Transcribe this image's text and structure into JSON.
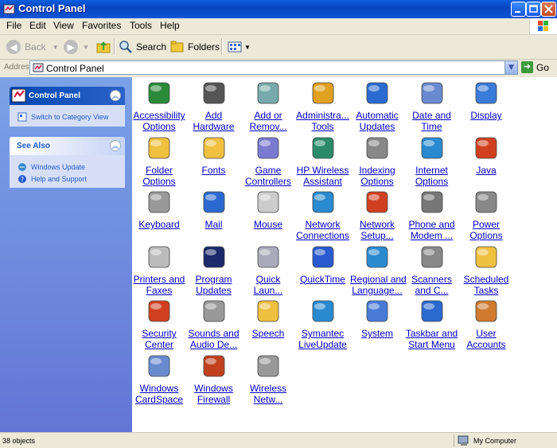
{
  "window": {
    "title": "Control Panel"
  },
  "menu": [
    "File",
    "Edit",
    "View",
    "Favorites",
    "Tools",
    "Help"
  ],
  "toolbar": {
    "back_label": "Back",
    "search_label": "Search",
    "folders_label": "Folders"
  },
  "address": {
    "label": "Address",
    "value": "Control Panel",
    "go_label": "Go"
  },
  "sidebar": {
    "control_panel": {
      "title": "Control Panel",
      "link": "Switch to Category View"
    },
    "see_also": {
      "title": "See Also",
      "links": [
        "Windows Update",
        "Help and Support"
      ]
    }
  },
  "items": [
    {
      "l1": "Accessibility",
      "l2": "Options",
      "icon": "accessibility-icon",
      "color": "#2a8a3a"
    },
    {
      "l1": "Add",
      "l2": "Hardware",
      "icon": "hardware-icon",
      "color": "#555"
    },
    {
      "l1": "Add or",
      "l2": "Remov...",
      "icon": "add-remove-programs-icon",
      "color": "#7aa"
    },
    {
      "l1": "Administra...",
      "l2": "Tools",
      "icon": "admin-tools-icon",
      "color": "#e0a020"
    },
    {
      "l1": "Automatic",
      "l2": "Updates",
      "icon": "automatic-updates-icon",
      "color": "#2a6ad0"
    },
    {
      "l1": "Date and",
      "l2": "Time",
      "icon": "date-time-icon",
      "color": "#6a8ad0"
    },
    {
      "l1": "Display",
      "l2": "",
      "icon": "display-icon",
      "color": "#3a7ad8"
    },
    {
      "l1": "Folder",
      "l2": "Options",
      "icon": "folder-options-icon",
      "color": "#f0c040"
    },
    {
      "l1": "Fonts",
      "l2": "",
      "icon": "fonts-icon",
      "color": "#f0c040"
    },
    {
      "l1": "Game",
      "l2": "Controllers",
      "icon": "game-controller-icon",
      "color": "#7a7ad0"
    },
    {
      "l1": "HP Wireless",
      "l2": "Assistant",
      "icon": "hp-wireless-icon",
      "color": "#2a8a6a"
    },
    {
      "l1": "Indexing",
      "l2": "Options",
      "icon": "indexing-icon",
      "color": "#888"
    },
    {
      "l1": "Internet",
      "l2": "Options",
      "icon": "internet-options-icon",
      "color": "#2a8ad0"
    },
    {
      "l1": "Java",
      "l2": "",
      "icon": "java-icon",
      "color": "#d04020"
    },
    {
      "l1": "Keyboard",
      "l2": "",
      "icon": "keyboard-icon",
      "color": "#999"
    },
    {
      "l1": "Mail",
      "l2": "",
      "icon": "mail-icon",
      "color": "#2a6ad0"
    },
    {
      "l1": "Mouse",
      "l2": "",
      "icon": "mouse-icon",
      "color": "#ccc"
    },
    {
      "l1": "Network",
      "l2": "Connections",
      "icon": "network-connections-icon",
      "color": "#2a8ad0"
    },
    {
      "l1": "Network",
      "l2": "Setup...",
      "icon": "network-setup-icon",
      "color": "#d04020"
    },
    {
      "l1": "Phone and",
      "l2": "Modem ...",
      "icon": "phone-modem-icon",
      "color": "#777"
    },
    {
      "l1": "Power",
      "l2": "Options",
      "icon": "power-options-icon",
      "color": "#888"
    },
    {
      "l1": "Printers and",
      "l2": "Faxes",
      "icon": "printer-icon",
      "color": "#bbb"
    },
    {
      "l1": "Program",
      "l2": "Updates",
      "icon": "program-updates-icon",
      "color": "#1a2a6a"
    },
    {
      "l1": "Quick",
      "l2": "Laun...",
      "icon": "quick-launch-icon",
      "color": "#aab"
    },
    {
      "l1": "QuickTime",
      "l2": "",
      "icon": "quicktime-icon",
      "color": "#2a5ad0"
    },
    {
      "l1": "Regional and",
      "l2": "Language...",
      "icon": "regional-language-icon",
      "color": "#2a8ad0"
    },
    {
      "l1": "Scanners",
      "l2": "and C...",
      "icon": "scanner-icon",
      "color": "#888"
    },
    {
      "l1": "Scheduled",
      "l2": "Tasks",
      "icon": "scheduled-tasks-icon",
      "color": "#f0c040"
    },
    {
      "l1": "Security",
      "l2": "Center",
      "icon": "security-center-icon",
      "color": "#d04020"
    },
    {
      "l1": "Sounds and",
      "l2": "Audio De...",
      "icon": "sound-icon",
      "color": "#999"
    },
    {
      "l1": "Speech",
      "l2": "",
      "icon": "speech-icon",
      "color": "#f0c040"
    },
    {
      "l1": "Symantec",
      "l2": "LiveUpdate",
      "icon": "symantec-liveupdate-icon",
      "color": "#2a8ad0"
    },
    {
      "l1": "System",
      "l2": "",
      "icon": "system-icon",
      "color": "#4a7ad8"
    },
    {
      "l1": "Taskbar and",
      "l2": "Start Menu",
      "icon": "taskbar-icon",
      "color": "#2a6ad0"
    },
    {
      "l1": "User",
      "l2": "Accounts",
      "icon": "user-accounts-icon",
      "color": "#d07a30"
    },
    {
      "l1": "Windows",
      "l2": "CardSpace",
      "icon": "cardspace-icon",
      "color": "#6a8ad0"
    },
    {
      "l1": "Windows",
      "l2": "Firewall",
      "icon": "firewall-icon",
      "color": "#c04020"
    },
    {
      "l1": "Wireless",
      "l2": "Netw...",
      "icon": "wireless-network-icon",
      "color": "#999"
    }
  ],
  "status": {
    "left": "38 objects",
    "right": "My Computer"
  }
}
